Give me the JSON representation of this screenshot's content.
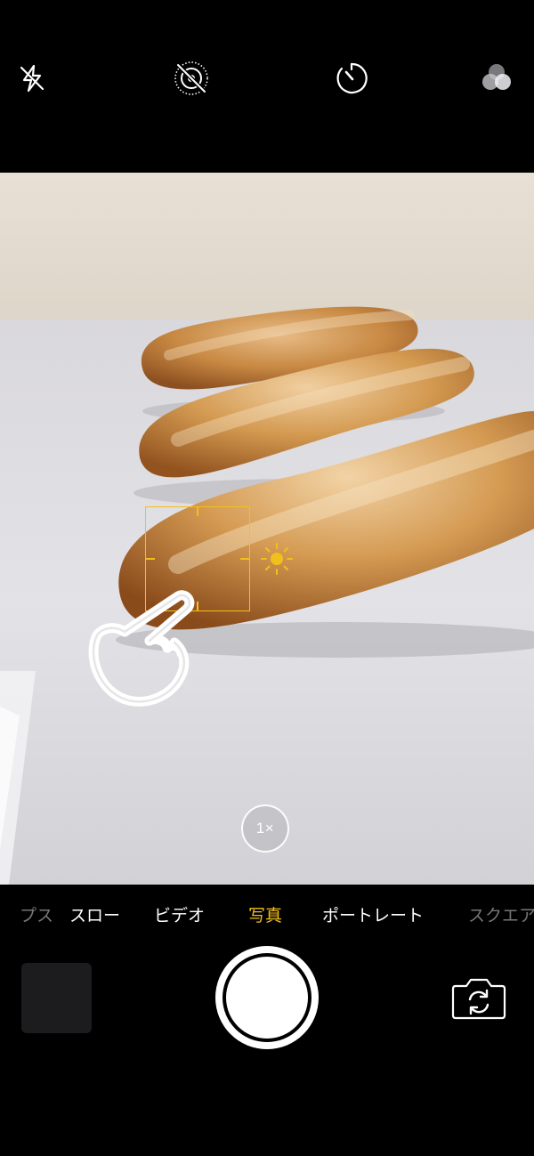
{
  "top_bar": {
    "icons": [
      "flash-off-icon",
      "live-photo-off-icon",
      "timer-icon",
      "filters-icon"
    ]
  },
  "viewfinder": {
    "subject": "baguettes",
    "zoom_label": "1×"
  },
  "colors": {
    "accent": "#f2bf1d",
    "background": "#000000",
    "text": "#ffffff"
  },
  "modes": {
    "items": [
      {
        "label": "プス",
        "state": "faded"
      },
      {
        "label": "スロー",
        "state": "normal"
      },
      {
        "label": "ビデオ",
        "state": "normal"
      },
      {
        "label": "写真",
        "state": "active"
      },
      {
        "label": "ポートレート",
        "state": "normal"
      },
      {
        "label": "スクエア",
        "state": "faded"
      }
    ]
  },
  "bottom_bar": {
    "icons": [
      "thumbnail",
      "shutter-button",
      "flip-camera-icon"
    ]
  }
}
